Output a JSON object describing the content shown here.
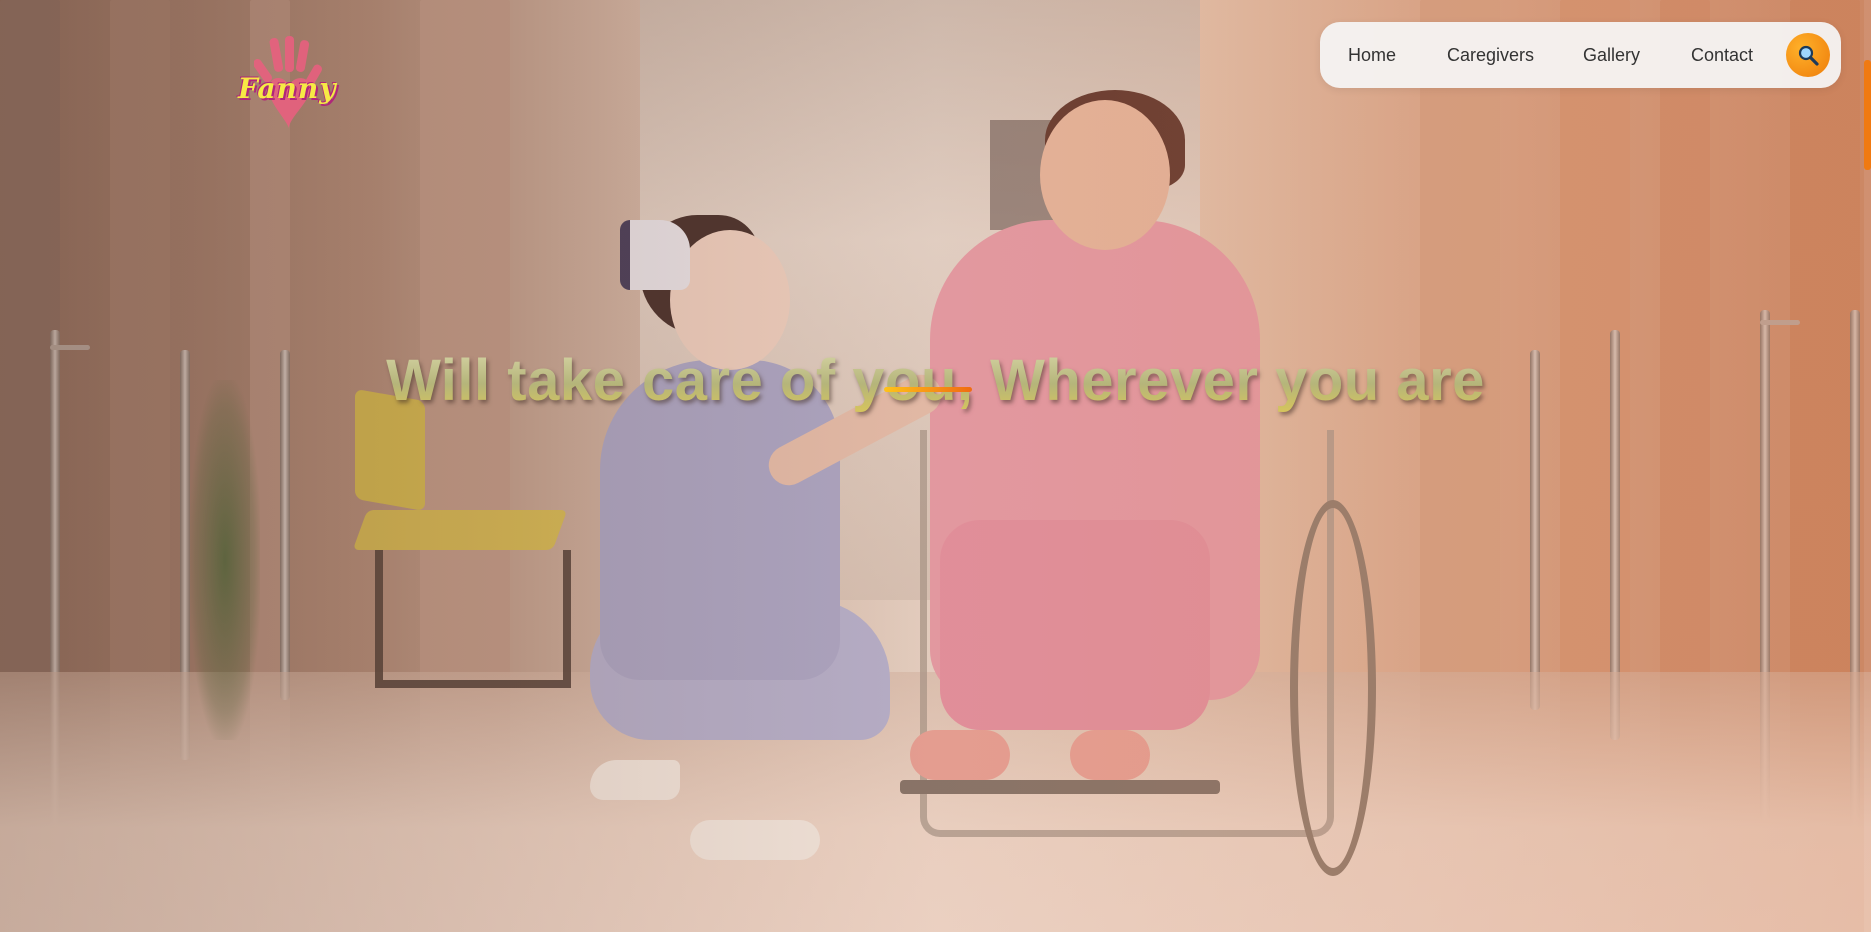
{
  "logo": {
    "text": "Fanny",
    "icon": "handprint-heart-icon"
  },
  "nav": {
    "items": [
      {
        "label": "Home"
      },
      {
        "label": "Caregivers"
      },
      {
        "label": "Gallery"
      },
      {
        "label": "Contact"
      }
    ],
    "search_icon": "search-icon",
    "accent_color": "#f39211"
  },
  "hero": {
    "headline": "Will take care of you, Wherever you are",
    "underline_color": "#f5a019"
  }
}
